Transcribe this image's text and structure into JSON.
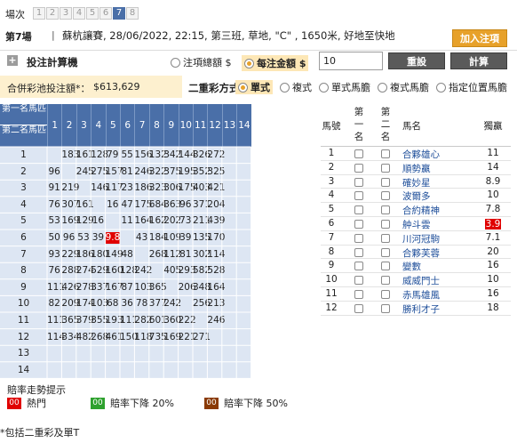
{
  "race_nav": {
    "label": "場次",
    "tabs": [
      "1",
      "2",
      "3",
      "4",
      "5",
      "6",
      "7",
      "8"
    ],
    "active_index": 6
  },
  "race": {
    "title": "第7場",
    "separator": "|",
    "info": "蘇杭讓賽, 28/06/2022, 22:15, 第三班, 草地, \"C\" , 1650米, 好地至快地"
  },
  "add_button": "加入注項",
  "calculator": {
    "title": "投注計算機",
    "opt_total": "注項總額 $",
    "opt_unit": "每注金額 $",
    "amount": "10",
    "reset": "重設",
    "calc": "計算",
    "combo_label": "合併彩池投注額*：",
    "combo_value": "$613,629",
    "mode_label": "二重彩方式：",
    "modes": [
      "單式",
      "複式",
      "單式馬膽",
      "複式馬膽",
      "指定位置馬膽"
    ],
    "mode_selected": 0
  },
  "grid": {
    "corner_top": "第一名馬匹",
    "corner_bottom": "第二名馬匹",
    "cols": [
      "1",
      "2",
      "3",
      "4",
      "5",
      "6",
      "7",
      "8",
      "9",
      "10",
      "11",
      "12",
      "13",
      "14"
    ],
    "rows": [
      {
        "label": "1",
        "cells": [
          "",
          "183",
          "161",
          "128",
          "79",
          "55",
          "156",
          "132",
          "342",
          "144",
          "326",
          "272",
          "",
          ""
        ]
      },
      {
        "label": "2",
        "cells": [
          "96",
          "",
          "245",
          "275",
          "157",
          "81",
          "246",
          "322",
          "375",
          "195",
          "352",
          "325",
          "",
          ""
        ]
      },
      {
        "label": "3",
        "cells": [
          "91",
          "219",
          "",
          "146",
          "117",
          "23",
          "186",
          "323",
          "306",
          "175",
          "403",
          "421",
          "",
          ""
        ]
      },
      {
        "label": "4",
        "cells": [
          "76",
          "307",
          "161",
          "",
          "16",
          "47",
          "175",
          "684",
          "363",
          "96",
          "371",
          "204",
          "",
          ""
        ]
      },
      {
        "label": "5",
        "cells": [
          "53",
          "169",
          "129",
          "16",
          "",
          "11",
          "164",
          "162",
          "202",
          "73",
          "211",
          "439",
          "",
          ""
        ]
      },
      {
        "label": "6",
        "cells": [
          "50",
          "96",
          "53",
          "39",
          "9.8",
          "",
          "43",
          "184",
          "109",
          "39",
          "135",
          "170",
          "",
          ""
        ]
      },
      {
        "label": "7",
        "cells": [
          "93",
          "229",
          "186",
          "180",
          "149",
          "48",
          "",
          "268",
          "112",
          "81",
          "302",
          "114",
          "",
          ""
        ]
      },
      {
        "label": "8",
        "cells": [
          "76",
          "288",
          "274",
          "529",
          "160",
          "128",
          "242",
          "",
          "405",
          "293",
          "582",
          "528",
          "",
          ""
        ]
      },
      {
        "label": "9",
        "cells": [
          "111",
          "426",
          "278",
          "337",
          "167",
          "87",
          "103",
          "365",
          "",
          "206",
          "348",
          "164",
          "",
          ""
        ]
      },
      {
        "label": "10",
        "cells": [
          "82",
          "209",
          "174",
          "103",
          "68",
          "36",
          "78",
          "377",
          "242",
          "",
          "256",
          "213",
          "",
          ""
        ]
      },
      {
        "label": "11",
        "cells": [
          "111",
          "365",
          "379",
          "355",
          "193",
          "111",
          "282",
          "601",
          "360",
          "222",
          "",
          "246",
          "",
          ""
        ]
      },
      {
        "label": "12",
        "cells": [
          "114",
          "334",
          "482",
          "268",
          "461",
          "150",
          "118",
          "735",
          "169",
          "221",
          "271",
          "",
          "",
          ""
        ]
      },
      {
        "label": "13",
        "cells": [
          "",
          "",
          "",
          "",
          "",
          "",
          "",
          "",
          "",
          "",
          "",
          "",
          "",
          ""
        ]
      },
      {
        "label": "14",
        "cells": [
          "",
          "",
          "",
          "",
          "",
          "",
          "",
          "",
          "",
          "",
          "",
          "",
          "",
          ""
        ]
      }
    ],
    "hot_cell": {
      "row": 5,
      "col": 4
    }
  },
  "horse_list": {
    "headers": {
      "no": "馬號",
      "first": "第\n一\n名",
      "second": "第\n二\n名",
      "name": "馬名",
      "odds": "獨贏"
    },
    "horses": [
      {
        "no": "1",
        "name": "合夥雄心",
        "odds": "11"
      },
      {
        "no": "2",
        "name": "順勢贏",
        "odds": "14"
      },
      {
        "no": "3",
        "name": "確妙星",
        "odds": "8.9"
      },
      {
        "no": "4",
        "name": "波爾多",
        "odds": "10"
      },
      {
        "no": "5",
        "name": "合約精神",
        "odds": "7.8"
      },
      {
        "no": "6",
        "name": "舯斗雲",
        "odds": "3.9",
        "hot": true
      },
      {
        "no": "7",
        "name": "川河冠駒",
        "odds": "7.1"
      },
      {
        "no": "8",
        "name": "合夥芙蓉",
        "odds": "20"
      },
      {
        "no": "9",
        "name": "變數",
        "odds": "16"
      },
      {
        "no": "10",
        "name": "威威門士",
        "odds": "10"
      },
      {
        "no": "11",
        "name": "赤馬雄風",
        "odds": "16"
      },
      {
        "no": "12",
        "name": "勝利才子",
        "odds": "18"
      }
    ]
  },
  "legend": {
    "title": "賠率走勢提示",
    "items": [
      {
        "badge": "00",
        "text": "熱門",
        "color": "#e00000"
      },
      {
        "badge": "00",
        "text": "賠率下降 20%",
        "color": "#2ea12e"
      },
      {
        "badge": "00",
        "text": "賠率下降 50%",
        "color": "#8a3a05"
      }
    ]
  },
  "footnote": "*包括二重彩及單T",
  "colors": {
    "header_blue": "#4a6fa8",
    "grid_bg": "#dde6f3",
    "accent_orange": "#e7a12a",
    "hot_red": "#e00000",
    "link_blue": "#1f4f9a"
  }
}
